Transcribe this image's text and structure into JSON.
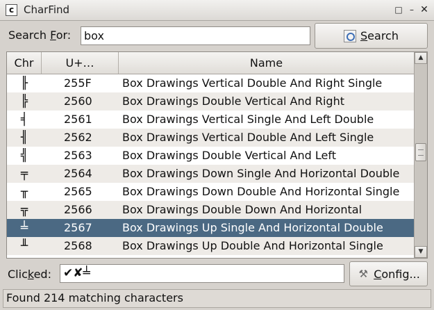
{
  "window": {
    "title": "CharFind",
    "app_icon": "c",
    "controls": {
      "restore": "□",
      "minimize": "–",
      "close": "✕"
    }
  },
  "search": {
    "label_pre": "Search ",
    "label_key": "F",
    "label_post": "or:",
    "value": "box",
    "button_icon": "search-icon",
    "button_key": "S",
    "button_rest": "earch"
  },
  "table": {
    "columns": [
      "Chr",
      "U+…",
      "Name"
    ],
    "rows": [
      {
        "chr": "╟",
        "code": "255F",
        "name": "Box Drawings Vertical Double And Right Single"
      },
      {
        "chr": "╠",
        "code": "2560",
        "name": "Box Drawings Double Vertical And Right"
      },
      {
        "chr": "╡",
        "code": "2561",
        "name": "Box Drawings Vertical Single And Left Double"
      },
      {
        "chr": "╢",
        "code": "2562",
        "name": "Box Drawings Vertical Double And Left Single"
      },
      {
        "chr": "╣",
        "code": "2563",
        "name": "Box Drawings Double Vertical And Left"
      },
      {
        "chr": "╤",
        "code": "2564",
        "name": "Box Drawings Down Single And Horizontal Double"
      },
      {
        "chr": "╥",
        "code": "2565",
        "name": "Box Drawings Down Double And Horizontal Single"
      },
      {
        "chr": "╦",
        "code": "2566",
        "name": "Box Drawings Double Down And Horizontal"
      },
      {
        "chr": "╧",
        "code": "2567",
        "name": "Box Drawings Up Single And Horizontal Double"
      },
      {
        "chr": "╨",
        "code": "2568",
        "name": "Box Drawings Up Double And Horizontal Single"
      }
    ],
    "selected_code": "2567",
    "scroll": {
      "up_arrow": "▲",
      "down_arrow": "▼"
    }
  },
  "clicked": {
    "label_pre": "Clic",
    "label_key": "k",
    "label_post": "ed:",
    "value": "✔✘╧"
  },
  "config": {
    "icon": "tools-icon",
    "label_key": "C",
    "label_rest": "onfig..."
  },
  "status": {
    "text": "Found 214 matching characters"
  }
}
